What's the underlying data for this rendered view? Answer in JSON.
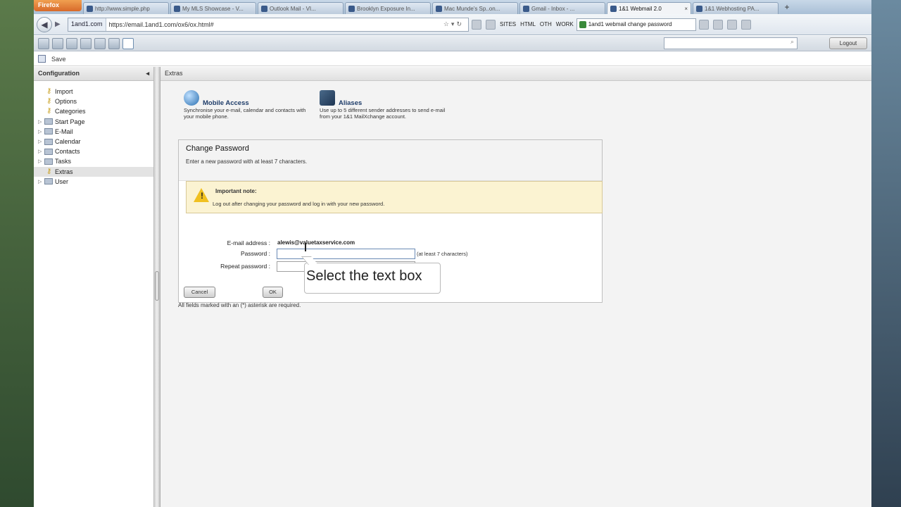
{
  "browser": {
    "menu_button": "Firefox",
    "tabs": [
      {
        "label": "http://www.simple.php",
        "active": false
      },
      {
        "label": "My MLS Showcase - V...",
        "active": false
      },
      {
        "label": "Outlook Mail - VI...",
        "active": false
      },
      {
        "label": "Brooklyn Exposure In...",
        "active": false
      },
      {
        "label": "Mac Munde's Sp..on...",
        "active": false
      },
      {
        "label": "Gmail - Inbox - ...",
        "active": false
      },
      {
        "label": "1&1 Webmail 2.0",
        "active": true
      },
      {
        "label": "1&1 Webhosting PA...",
        "active": false
      }
    ],
    "new_tab": "+",
    "site_identity": "1and1.com",
    "url": "https://email.1and1.com/ox6/ox.html#",
    "bookmarks": [
      "SITES",
      "HTML",
      "OTH",
      "WORK"
    ],
    "search_query": "1and1 webmail change password"
  },
  "app": {
    "logout_label": "Logout",
    "save_label": "Save",
    "search_placeholder": ""
  },
  "sidebar": {
    "title": "Configuration",
    "collapse": "◂",
    "items": [
      {
        "label": "Import",
        "type": "key",
        "expandable": false
      },
      {
        "label": "Options",
        "type": "key",
        "expandable": false
      },
      {
        "label": "Categories",
        "type": "key",
        "expandable": false
      },
      {
        "label": "Start Page",
        "type": "folder",
        "expandable": true
      },
      {
        "label": "E-Mail",
        "type": "folder",
        "expandable": true
      },
      {
        "label": "Calendar",
        "type": "folder",
        "expandable": true
      },
      {
        "label": "Contacts",
        "type": "folder",
        "expandable": true
      },
      {
        "label": "Tasks",
        "type": "folder",
        "expandable": true
      },
      {
        "label": "Extras",
        "type": "key",
        "expandable": false,
        "selected": true
      },
      {
        "label": "User",
        "type": "folder",
        "expandable": true
      }
    ]
  },
  "main": {
    "header": "Extras",
    "features": [
      {
        "title": "Mobile Access",
        "description": "Synchronise your e-mail, calendar and contacts with your mobile phone."
      },
      {
        "title": "Aliases",
        "description": "Use up to 5 different sender addresses to send e-mail from your 1&1 MailXchange account."
      }
    ],
    "change_password": {
      "title": "Change Password",
      "subtitle": "Enter a new password with at least 7 characters.",
      "note_title": "Important note:",
      "note_text": "Log out after changing your password and log in with your new password.",
      "email_label": "E-mail address :",
      "email_value": "alewis@valuetaxservice.com",
      "password_label": "Password :",
      "password_hint": "(at least 7 characters)",
      "repeat_label": "Repeat password :",
      "cancel_label": "Cancel",
      "ok_label": "OK"
    },
    "footer_note": "All fields marked with an (*) asterisk are required."
  },
  "tooltip": "Select the  text box"
}
